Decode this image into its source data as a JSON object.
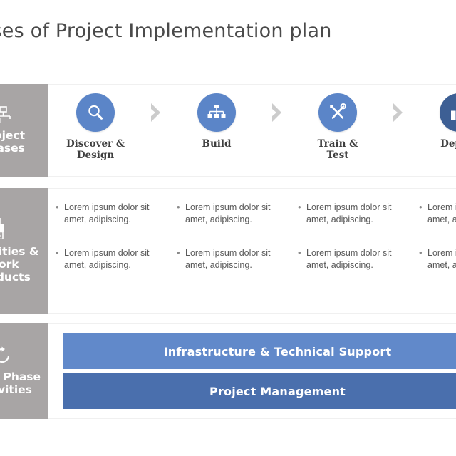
{
  "slide": {
    "title": "Phases of Project Implementation plan",
    "title_visible_fragment": "es of Project Implementation plan",
    "accent_light_blue": "#6189ca",
    "accent_dark_blue": "#4a6fad",
    "circle_blue": "#5b85c8",
    "circle_blue_dark": "#3d5f94",
    "sidebar_gray": "#a8a5a5",
    "chevron_gray": "#cccccc"
  },
  "rows": {
    "phases": {
      "label": "Project\nPhases",
      "label_visible_fragment": "ect\nses",
      "icon": "sitemap-icon",
      "items": [
        {
          "icon": "magnifier-icon",
          "name": "Discover &\nDesign",
          "tone": "light"
        },
        {
          "icon": "hierarchy-icon",
          "name": "Build",
          "tone": "light"
        },
        {
          "icon": "tools-icon",
          "name": "Train &\nTest",
          "tone": "light"
        },
        {
          "icon": "thumbs-up-icon",
          "name": "Deploy",
          "tone": "dark"
        }
      ],
      "separator_icon": "chevron-right-icon"
    },
    "activities": {
      "label": "Activities &\nWork\nProducts",
      "label_visible_fragment": "ties &\nrk\nucts",
      "icon": "documents-icon",
      "columns": [
        {
          "bullets": [
            "Lorem ipsum dolor sit amet, adipiscing.",
            "Lorem ipsum dolor sit amet, adipiscing."
          ]
        },
        {
          "bullets": [
            "Lorem ipsum dolor sit amet, adipiscing.",
            "Lorem ipsum dolor sit amet, adipiscing."
          ]
        },
        {
          "bullets": [
            "Lorem ipsum dolor sit amet, adipiscing.",
            "Lorem ipsum dolor sit amet, adipiscing."
          ]
        },
        {
          "bullets": [
            "Lorem ipsum dolor sit amet, adipiscing.",
            "Lorem ipsum dolor sit amet, adipiscing."
          ]
        }
      ],
      "bullet_glyph": "•"
    },
    "cross_phase": {
      "label": "Cross Phase\nActivities",
      "label_visible_fragment": "Phase\nities",
      "icon": "cycle-icon",
      "bars": [
        {
          "text": "Infrastructure & Technical Support",
          "tone": "light"
        },
        {
          "text": "Project Management",
          "tone": "dark"
        }
      ]
    }
  }
}
